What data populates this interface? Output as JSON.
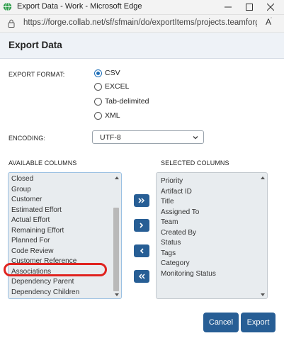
{
  "window": {
    "title": "Export Data - Work - Microsoft Edge",
    "app_icon": "globe-icon",
    "controls": [
      "minimize-icon",
      "maximize-icon",
      "close-icon"
    ]
  },
  "addressbar": {
    "url": "https://forge.collab.net/sf/sfmain/do/exportItems/projects.teamforge/tra...",
    "reader_label": "A",
    "reader_sup": "҅"
  },
  "dialog": {
    "title": "Export Data",
    "export_format_label": "EXPORT FORMAT:",
    "formats": [
      {
        "label": "CSV",
        "selected": true
      },
      {
        "label": "EXCEL",
        "selected": false
      },
      {
        "label": "Tab-delimited",
        "selected": false
      },
      {
        "label": "XML",
        "selected": false
      }
    ],
    "encoding_label": "ENCODING:",
    "encoding_value": "UTF-8",
    "available_label": "AVAILABLE COLUMNS",
    "selected_label": "SELECTED COLUMNS",
    "available_columns": [
      "Closed",
      "Group",
      "Customer",
      "Estimated Effort",
      "Actual Effort",
      "Remaining Effort",
      "Planned For",
      "Code Review",
      "Customer Reference",
      "Associations",
      "Dependency Parent",
      "Dependency Children"
    ],
    "selected_columns": [
      "Priority",
      "Artifact ID",
      "Title",
      "Assigned To",
      "Team",
      "Created By",
      "Status",
      "Tags",
      "Category",
      "Monitoring Status"
    ],
    "move_buttons": [
      "double-right-arrow-icon",
      "right-arrow-icon",
      "left-arrow-icon",
      "double-left-arrow-icon"
    ],
    "cancel_label": "Cancel",
    "export_label": "Export"
  },
  "colors": {
    "primary": "#275e95",
    "radio_selected": "#1f6fb8",
    "highlight": "#e0231f",
    "header_bg": "#eef2f7",
    "list_bg": "#e8ecef"
  }
}
